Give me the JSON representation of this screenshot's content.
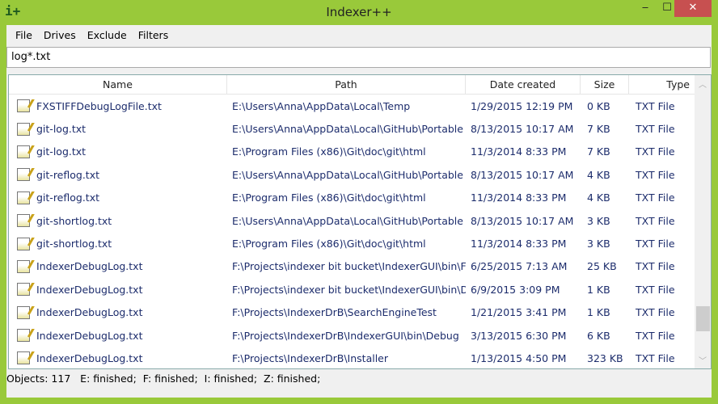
{
  "window": {
    "title": "Indexer++",
    "icon": "i+",
    "minimize": "‒",
    "maximize": "☐",
    "close": "✕"
  },
  "menu": [
    "File",
    "Drives",
    "Exclude",
    "Filters"
  ],
  "search": {
    "value": "log*.txt"
  },
  "columns": [
    "Name",
    "Path",
    "Date created",
    "Size",
    "Type"
  ],
  "rows": [
    {
      "name": "FXSTIFFDebugLogFile.txt",
      "path": "E:\\Users\\Anna\\AppData\\Local\\Temp",
      "date": "1/29/2015 12:19 PM",
      "size": "0 KB",
      "type": "TXT File"
    },
    {
      "name": "git-log.txt",
      "path": "E:\\Users\\Anna\\AppData\\Local\\GitHub\\Portable",
      "date": "8/13/2015 10:17 AM",
      "size": "7 KB",
      "type": "TXT File"
    },
    {
      "name": "git-log.txt",
      "path": "E:\\Program Files (x86)\\Git\\doc\\git\\html",
      "date": "11/3/2014 8:33 PM",
      "size": "7 KB",
      "type": "TXT File"
    },
    {
      "name": "git-reflog.txt",
      "path": "E:\\Users\\Anna\\AppData\\Local\\GitHub\\Portable",
      "date": "8/13/2015 10:17 AM",
      "size": "4 KB",
      "type": "TXT File"
    },
    {
      "name": "git-reflog.txt",
      "path": "E:\\Program Files (x86)\\Git\\doc\\git\\html",
      "date": "11/3/2014 8:33 PM",
      "size": "4 KB",
      "type": "TXT File"
    },
    {
      "name": "git-shortlog.txt",
      "path": "E:\\Users\\Anna\\AppData\\Local\\GitHub\\Portable",
      "date": "8/13/2015 10:17 AM",
      "size": "3 KB",
      "type": "TXT File"
    },
    {
      "name": "git-shortlog.txt",
      "path": "E:\\Program Files (x86)\\Git\\doc\\git\\html",
      "date": "11/3/2014 8:33 PM",
      "size": "3 KB",
      "type": "TXT File"
    },
    {
      "name": "IndexerDebugLog.txt",
      "path": "F:\\Projects\\indexer bit bucket\\IndexerGUI\\bin\\F",
      "date": "6/25/2015 7:13 AM",
      "size": "25 KB",
      "type": "TXT File"
    },
    {
      "name": "IndexerDebugLog.txt",
      "path": "F:\\Projects\\indexer bit bucket\\IndexerGUI\\bin\\D",
      "date": "6/9/2015 3:09 PM",
      "size": "1 KB",
      "type": "TXT File"
    },
    {
      "name": "IndexerDebugLog.txt",
      "path": "F:\\Projects\\IndexerDrB\\SearchEngineTest",
      "date": "1/21/2015 3:41 PM",
      "size": "1 KB",
      "type": "TXT File"
    },
    {
      "name": "IndexerDebugLog.txt",
      "path": "F:\\Projects\\IndexerDrB\\IndexerGUI\\bin\\Debug",
      "date": "3/13/2015 6:30 PM",
      "size": "6 KB",
      "type": "TXT File"
    },
    {
      "name": "IndexerDebugLog.txt",
      "path": "F:\\Projects\\IndexerDrB\\Installer",
      "date": "1/13/2015 4:50 PM",
      "size": "323 KB",
      "type": "TXT File"
    }
  ],
  "scroll_position": 0.9,
  "status": "Objects: 117   E: finished;  F: finished;  I: finished;  Z: finished;"
}
